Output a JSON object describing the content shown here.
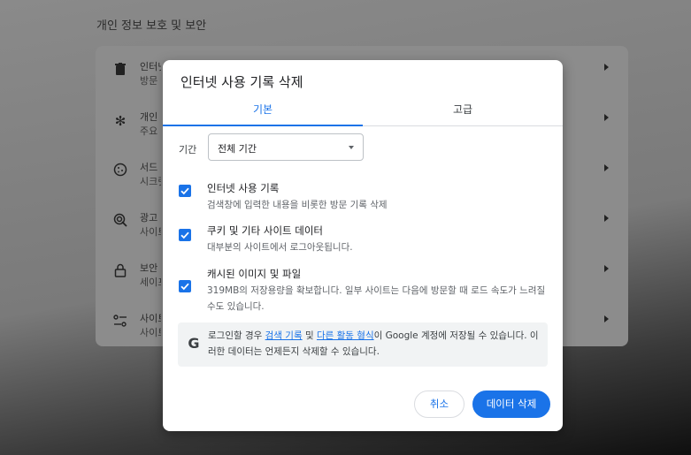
{
  "background": {
    "section_title": "개인 정보 보호 및 보안",
    "rows": [
      {
        "icon": "trash-icon",
        "title": "인터넷 사용 기록 삭제",
        "subtitle": "방문 기록, 쿠키, 캐시 등 삭제"
      },
      {
        "icon": "privacy-guide-icon",
        "title": "개인 정보 보호 가이드",
        "subtitle": "주요 개인 정보 보호 및 보안 관리 검토"
      },
      {
        "icon": "cookie-icon",
        "title": "서드 파티 쿠키",
        "subtitle": "시크릿 모드에서 서드 파티 쿠키가 차단됨"
      },
      {
        "icon": "ad-privacy-icon",
        "title": "광고 개인 정보 보호",
        "subtitle": "사이트에서 광고를 게재하는 데 사용하는 정보를 맞춤설정합니다"
      },
      {
        "icon": "lock-icon",
        "title": "보안",
        "subtitle": "세이프 브라우징 및 기타 보안 설정"
      },
      {
        "icon": "tune-icon",
        "title": "사이트 설정",
        "subtitle": "사이트에서 사용하고 표시할 수 있는 정보 제어"
      }
    ]
  },
  "dialog": {
    "title": "인터넷 사용 기록 삭제",
    "tabs": [
      {
        "label": "기본",
        "active": true
      },
      {
        "label": "고급",
        "active": false
      }
    ],
    "period": {
      "label": "기간",
      "value": "전체 기간"
    },
    "options": [
      {
        "title": "인터넷 사용 기록",
        "description": "검색창에 입력한 내용을 비롯한 방문 기록 삭제",
        "checked": true
      },
      {
        "title": "쿠키 및 기타 사이트 데이터",
        "description": "대부분의 사이트에서 로그아웃됩니다.",
        "checked": true
      },
      {
        "title": "캐시된 이미지 및 파일",
        "description": "319MB의 저장용량을 확보합니다. 일부 사이트는 다음에 방문할 때 로드 속도가 느려질 수도 있습니다.",
        "checked": true
      }
    ],
    "info": {
      "icon": "google-icon",
      "glyph": "G",
      "text_before": "로그인할 경우 ",
      "link1": "검색 기록",
      "text_middle": " 및 ",
      "link2": "다른 활동 형식",
      "text_after": "이 Google 계정에 저장될 수 있습니다. 이러한 데이터는 언제든지 삭제할 수 있습니다."
    },
    "buttons": {
      "cancel": "취소",
      "delete": "데이터 삭제"
    }
  },
  "colors": {
    "accent": "#1a73e8",
    "dialog_bg": "#ffffff",
    "info_bg": "#f1f3f4"
  }
}
